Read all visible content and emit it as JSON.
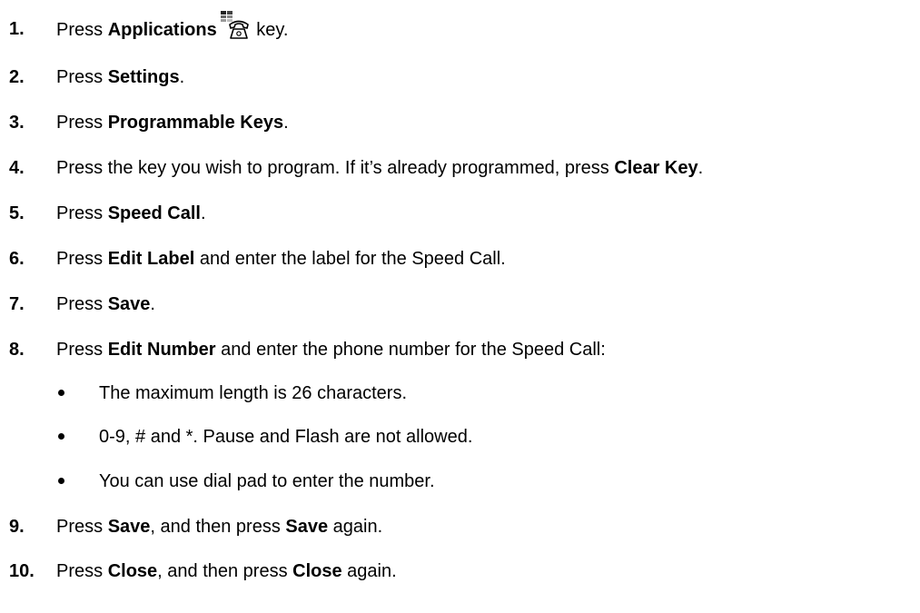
{
  "steps": [
    {
      "num": "1.",
      "parts": [
        {
          "t": "Press "
        },
        {
          "b": "Applications"
        },
        {
          "icon": "applications-key-icon"
        },
        {
          "t": " key."
        }
      ]
    },
    {
      "num": "2.",
      "parts": [
        {
          "t": "Press "
        },
        {
          "b": "Settings"
        },
        {
          "t": "."
        }
      ]
    },
    {
      "num": "3.",
      "parts": [
        {
          "t": "Press "
        },
        {
          "b": "Programmable Keys"
        },
        {
          "t": "."
        }
      ]
    },
    {
      "num": "4.",
      "parts": [
        {
          "t": "Press the key you wish to program. If it’s already programmed, press "
        },
        {
          "b": "Clear Key"
        },
        {
          "t": "."
        }
      ]
    },
    {
      "num": "5.",
      "parts": [
        {
          "t": "Press "
        },
        {
          "b": "Speed Call"
        },
        {
          "t": "."
        }
      ]
    },
    {
      "num": "6.",
      "parts": [
        {
          "t": "Press "
        },
        {
          "b": "Edit Label"
        },
        {
          "t": " and enter the label for the Speed Call."
        }
      ]
    },
    {
      "num": "7.",
      "parts": [
        {
          "t": "Press "
        },
        {
          "b": "Save"
        },
        {
          "t": "."
        }
      ]
    },
    {
      "num": "8.",
      "parts": [
        {
          "t": "Press "
        },
        {
          "b": "Edit Number"
        },
        {
          "t": " and enter the phone number for the Speed Call:"
        }
      ]
    },
    {
      "num": "9.",
      "parts": [
        {
          "t": "Press "
        },
        {
          "b": "Save"
        },
        {
          "t": ", and then press "
        },
        {
          "b": "Save"
        },
        {
          "t": " again."
        }
      ]
    },
    {
      "num": "10.",
      "parts": [
        {
          "t": "Press "
        },
        {
          "b": "Close"
        },
        {
          "t": ", and then press "
        },
        {
          "b": "Close"
        },
        {
          "t": " again."
        }
      ]
    }
  ],
  "bullets": [
    "The maximum length is 26 characters.",
    "0-9, # and *. Pause and Flash are not allowed.",
    "You can use dial pad to enter the number."
  ]
}
